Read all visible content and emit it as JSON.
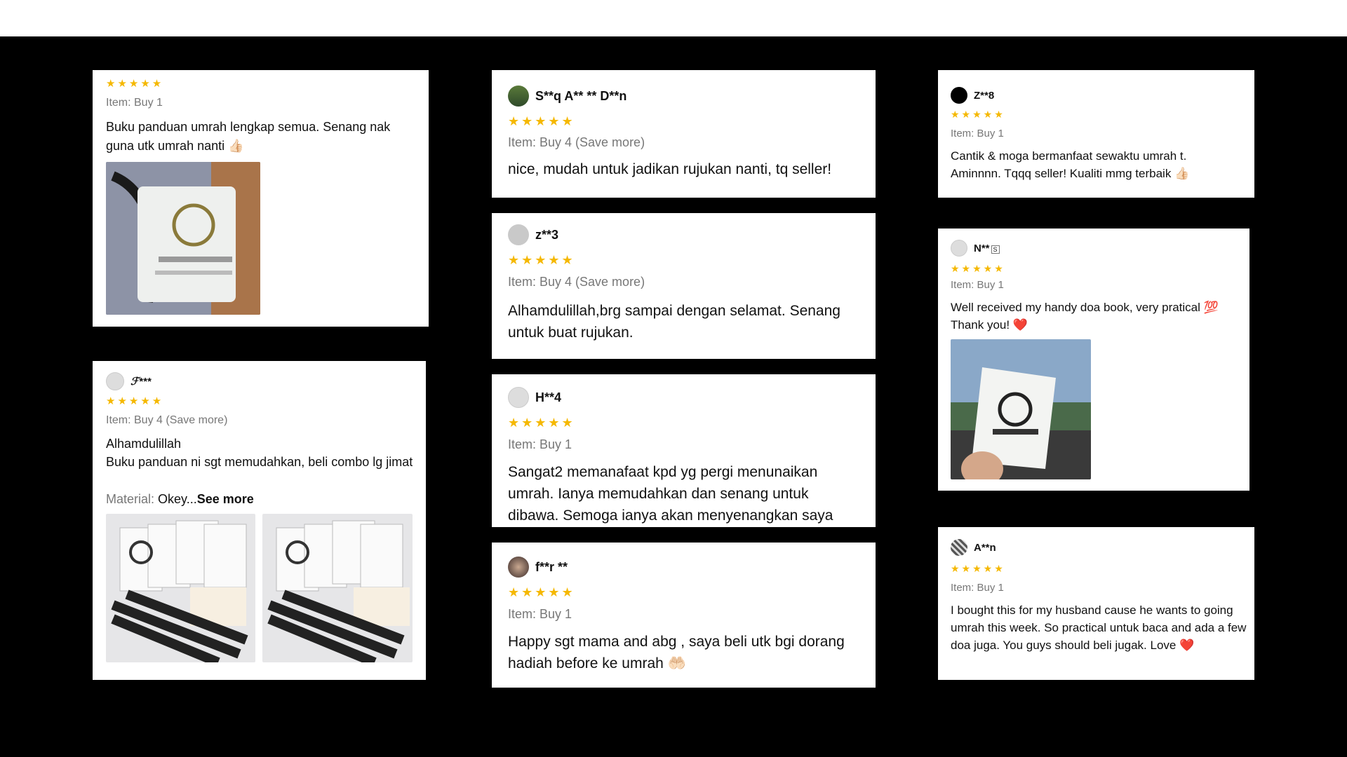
{
  "colors": {
    "background": "#000000",
    "card": "#ffffff",
    "star": "#f5b800",
    "muted": "#777777",
    "text": "#111111"
  },
  "reviews": [
    {
      "id": "r1",
      "user": "",
      "stars": "★★★★★",
      "item": "Item: Buy 1",
      "text": "Buku panduan umrah lengkap semua. Senang nak guna utk umrah nanti",
      "emoji": "👍🏻",
      "photo_icon": "lanyard-card-photo"
    },
    {
      "id": "r2",
      "user": "ℱ***",
      "stars": "★★★★★",
      "item": "Item: Buy 4 (Save more)",
      "text": "Alhamdulillah\nBuku panduan ni sgt memudahkan, beli combo lg jimat",
      "material_label": "Material:",
      "material_value": " Okey...",
      "see_more": "See more",
      "photo_icon": "baitullah-set-photo"
    },
    {
      "id": "r3",
      "user": "S**q A** ** D**n",
      "stars": "★★★★★",
      "item": "Item: Buy 4 (Save more)",
      "text": "nice, mudah untuk jadikan rujukan nanti, tq seller!"
    },
    {
      "id": "r4",
      "user": "z**3",
      "stars": "★★★★★",
      "item": "Item: Buy 4 (Save more)",
      "text": "Alhamdulillah,brg sampai dengan selamat. Senang untuk buat rujukan."
    },
    {
      "id": "r5",
      "user": "H**4",
      "stars": "★★★★★",
      "item": "Item: Buy 1",
      "text": "Sangat2 memanafaat kpd yg pergi menunaikan umrah. Ianya memudahkan dan senang untuk dibawa. Semoga ianya akan menyenangkan saya"
    },
    {
      "id": "r6",
      "user": "f**r **",
      "stars": "★★★★★",
      "item": "Item: Buy 1",
      "text": "Happy sgt mama and abg , saya beli utk bgi dorang hadiah before ke umrah",
      "emoji": "🤲🏻"
    },
    {
      "id": "r7",
      "user": "Z**8",
      "stars": "★★★★★",
      "item": "Item: Buy 1",
      "text": "Cantik & moga bermanfaat sewaktu umrah t. Aminnnn. Tqqq seller! Kualiti mmg terbaik",
      "emoji": "👍🏻"
    },
    {
      "id": "r8",
      "user": "N**",
      "user_badge": "S",
      "stars": "★★★★★",
      "item": "Item: Buy 1",
      "text": "Well received my handy doa book, very pratical 💯\nThank you!",
      "emoji": "❤️",
      "photo_icon": "baitullah-card-in-car-photo"
    },
    {
      "id": "r9",
      "user": "A**n",
      "stars": "★★★★★",
      "item": "Item: Buy 1",
      "text": "I bought this for my husband cause he wants to going umrah this week. So practical untuk baca and ada a few doa juga. You guys should beli jugak. Love",
      "emoji": "❤️"
    }
  ]
}
